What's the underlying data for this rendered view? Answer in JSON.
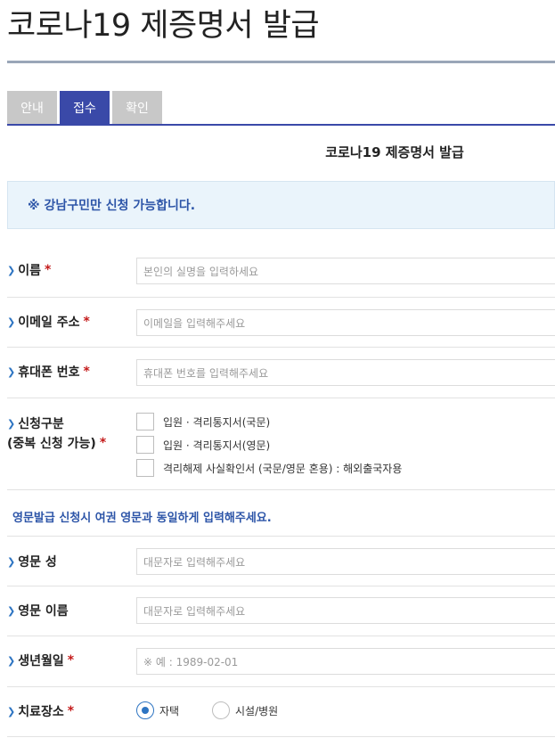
{
  "page": {
    "title": "코로나19 제증명서 발급"
  },
  "tabs": [
    {
      "label": "안내",
      "active": false
    },
    {
      "label": "접수",
      "active": true
    },
    {
      "label": "확인",
      "active": false
    }
  ],
  "form": {
    "title": "코로나19 제증명서 발급",
    "notice": "※ 강남구민만 신청 가능합니다.",
    "required_mark": "*",
    "name": {
      "label": "이름",
      "placeholder": "본인의 실명을 입력하세요"
    },
    "email": {
      "label": "이메일 주소",
      "placeholder": "이메일을 입력해주세요"
    },
    "phone": {
      "label": "휴대폰 번호",
      "placeholder": "휴대폰 번호를 입력해주세요"
    },
    "request_type": {
      "label_line1": "신청구분",
      "label_line2": "(중복 신청 가능)",
      "options": [
        {
          "label": "입원 · 격리통지서(국문)",
          "checked": false
        },
        {
          "label": "입원 · 격리통지서(영문)",
          "checked": false
        },
        {
          "label": "격리해제 사실확인서 (국문/영문 혼용) : 해외출국자용",
          "checked": false
        }
      ]
    },
    "english_notice": "영문발급 신청시 여권 영문과 동일하게 입력해주세요.",
    "en_surname": {
      "label": "영문 성",
      "placeholder": "대문자로 입력해주세요"
    },
    "en_given_name": {
      "label": "영문 이름",
      "placeholder": "대문자로 입력해주세요"
    },
    "birthdate": {
      "label": "생년월일",
      "placeholder": "※ 예 : 1989-02-01"
    },
    "treatment_place": {
      "label": "치료장소",
      "options": [
        {
          "label": "자택",
          "selected": true
        },
        {
          "label": "시설/병원",
          "selected": false
        }
      ]
    }
  },
  "colors": {
    "accent": "#3a49a8",
    "notice_text": "#2d55a8",
    "notice_bg": "#eaf4fb",
    "required": "#c41a1a",
    "tab_inactive": "#c8c8c8"
  },
  "icons": {
    "label_marker": "chevron-right-icon"
  }
}
